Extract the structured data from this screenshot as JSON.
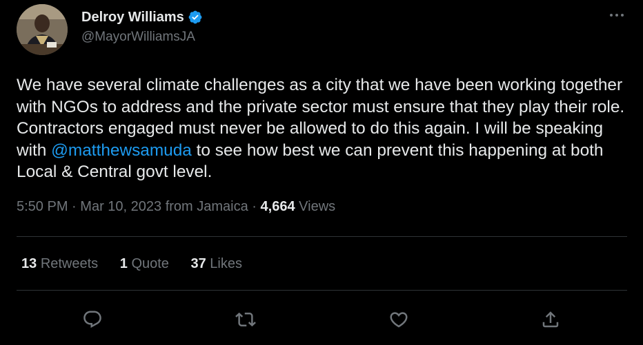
{
  "user": {
    "display_name": "Delroy Williams",
    "handle": "@MayorWilliamsJA",
    "verified": true
  },
  "tweet": {
    "text_before": "We have several climate challenges as a city that we have been working together with NGOs to address and the private sector must ensure that they play their role. Contractors engaged must never be allowed to do this again. I will be speaking with ",
    "mention": "@matthewsamuda",
    "text_after": " to see how best we can prevent this happening at both Local & Central govt level."
  },
  "meta": {
    "time": "5:50 PM",
    "separator": "·",
    "date": "Mar 10, 2023",
    "source": "from Jamaica",
    "views_count": "4,664",
    "views_label": "Views"
  },
  "stats": {
    "retweets_count": "13",
    "retweets_label": "Retweets",
    "quotes_count": "1",
    "quotes_label": "Quote",
    "likes_count": "37",
    "likes_label": "Likes"
  },
  "colors": {
    "background": "#000000",
    "text": "#e7e9ea",
    "secondary": "#71767b",
    "accent": "#1d9bf0",
    "divider": "#2f3336"
  },
  "icons": [
    "verified-badge-icon",
    "more-options-icon",
    "reply-icon",
    "retweet-icon",
    "like-icon",
    "share-icon"
  ]
}
